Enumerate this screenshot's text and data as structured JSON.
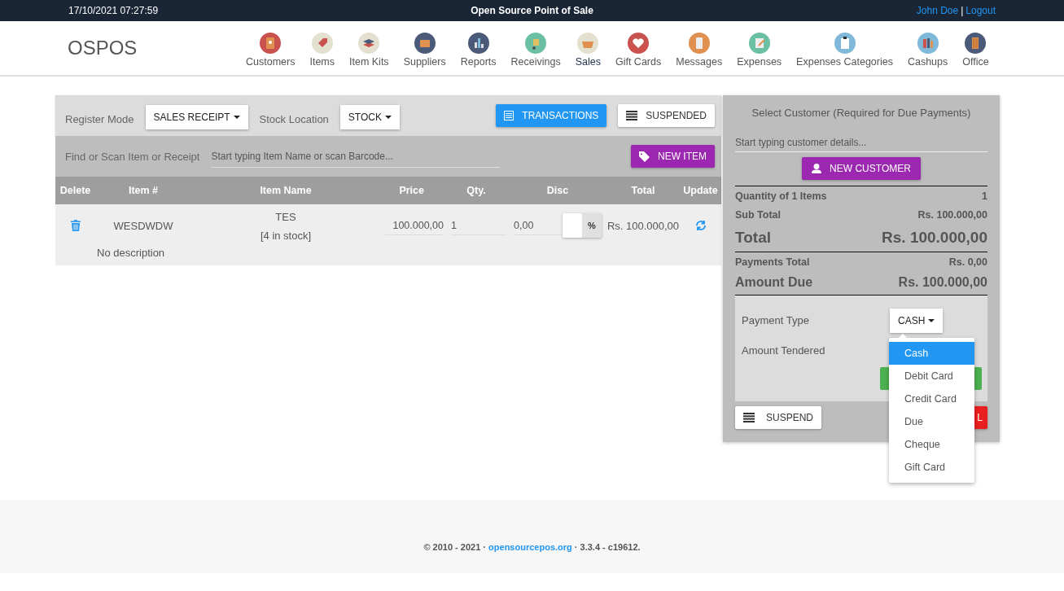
{
  "top_bar": {
    "datetime": "17/10/2021 07:27:59",
    "title": "Open Source Point of Sale",
    "user_link": "John Doe",
    "separator": "|",
    "logout_link": "Logout"
  },
  "header": {
    "logo": "OSPOS",
    "nav": [
      {
        "label": "Customers",
        "selected": false
      },
      {
        "label": "Items",
        "selected": false
      },
      {
        "label": "Item Kits",
        "selected": false
      },
      {
        "label": "Suppliers",
        "selected": false
      },
      {
        "label": "Reports",
        "selected": false
      },
      {
        "label": "Receivings",
        "selected": false
      },
      {
        "label": "Sales",
        "selected": true
      },
      {
        "label": "Gift Cards",
        "selected": false
      },
      {
        "label": "Messages",
        "selected": false
      },
      {
        "label": "Expenses",
        "selected": false
      },
      {
        "label": "Expenses Categories",
        "selected": false
      },
      {
        "label": "Cashups",
        "selected": false
      },
      {
        "label": "Office",
        "selected": false
      }
    ]
  },
  "register": {
    "mode_label": "Register Mode",
    "mode_value": "SALES RECEIPT",
    "location_label": "Stock Location",
    "location_value": "STOCK",
    "transactions_button": "TRANSACTIONS",
    "suspended_button": "SUSPENDED",
    "search_label": "Find or Scan Item or Receipt",
    "search_placeholder": "Start typing Item Name or scan Barcode...",
    "new_item_button": "NEW ITEM"
  },
  "cart": {
    "columns": [
      "Delete",
      "Item #",
      "Item Name",
      "Price",
      "Qty.",
      "Disc",
      "Total",
      "Update"
    ],
    "rows": [
      {
        "item_number": "WESDWDW",
        "name": "TES",
        "stock": "[4 in stock]",
        "price": "100.000,00",
        "qty": "1",
        "discount": "0,00",
        "discount_type": "%",
        "total": "Rs. 100.000,00",
        "description": "No description"
      }
    ]
  },
  "customer": {
    "title": "Select Customer (Required for Due Payments)",
    "placeholder": "Start typing customer details...",
    "new_customer_button": "NEW CUSTOMER"
  },
  "summary": [
    {
      "kind": "small",
      "label": "Quantity of 1 Items",
      "value": "1",
      "rule_before": true
    },
    {
      "kind": "small",
      "label": "Sub Total",
      "value": "Rs. 100.000,00",
      "rule_before": false
    },
    {
      "kind": "large",
      "label": "Total",
      "value": "Rs. 100.000,00",
      "rule_before": false
    },
    {
      "kind": "small",
      "label": "Payments Total",
      "value": "Rs. 0,00",
      "rule_before": true
    },
    {
      "kind": "medium",
      "label": "Amount Due",
      "value": "Rs. 100.000,00",
      "rule_before": false
    }
  ],
  "payment": {
    "type_label": "Payment Type",
    "type_value": "CASH",
    "tendered_label": "Amount Tendered",
    "options": [
      {
        "label": "Cash",
        "selected": true
      },
      {
        "label": "Debit Card",
        "selected": false
      },
      {
        "label": "Credit Card",
        "selected": false
      },
      {
        "label": "Due",
        "selected": false
      },
      {
        "label": "Cheque",
        "selected": false
      },
      {
        "label": "Gift Card",
        "selected": false
      }
    ],
    "suspend_button": "SUSPEND",
    "cancel_button_visible": "L"
  },
  "footer": {
    "before": "© 2010 - 2021 ·",
    "link": "opensourcepos.org",
    "after": "· 3.3.4 - c19612."
  }
}
